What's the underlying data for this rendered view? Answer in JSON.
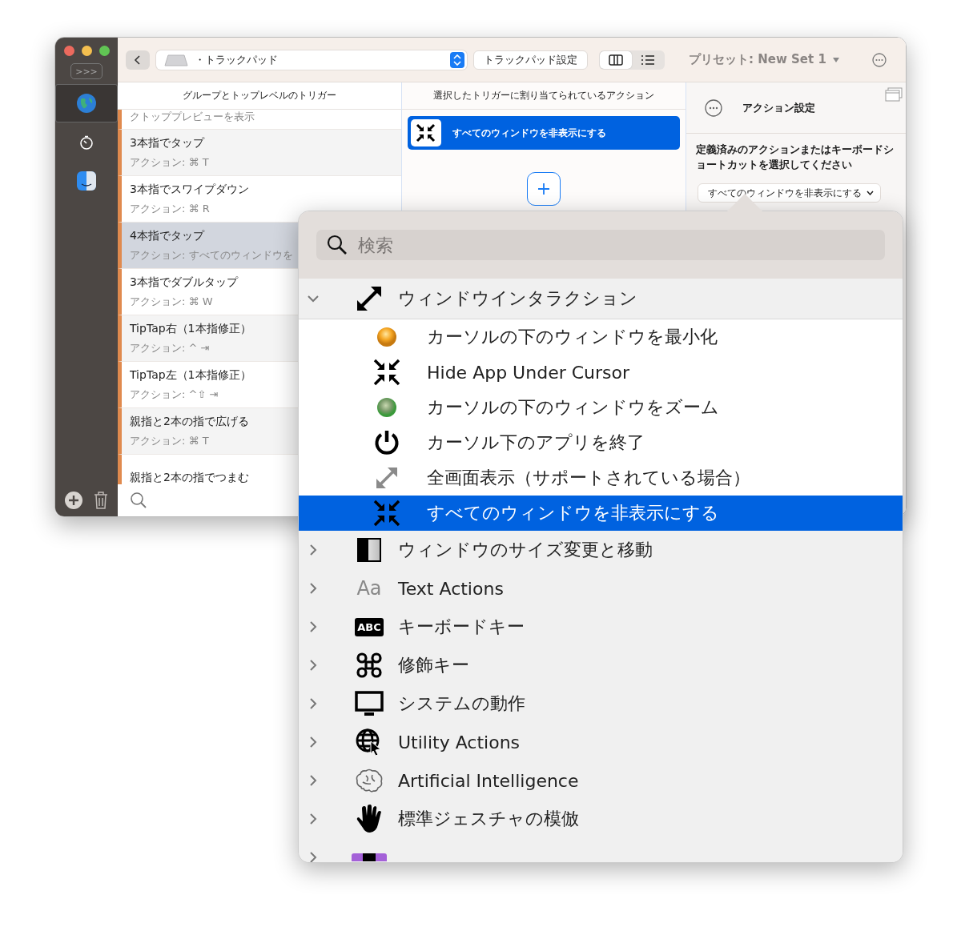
{
  "sidebar": {
    "expand_label": ">>>",
    "items": [
      {
        "kind": "globe",
        "selected": true
      },
      {
        "kind": "timer",
        "selected": false
      },
      {
        "kind": "app",
        "selected": false
      }
    ]
  },
  "toolbar": {
    "device": "・トラックパッド",
    "settings_button": "トラックパッド設定",
    "views": [
      {
        "kind": "columns",
        "selected": true
      },
      {
        "kind": "list",
        "selected": false
      }
    ],
    "preset": "プリセット: New Set 1"
  },
  "triggers": {
    "header": "グループとトップレベルのトリガー",
    "items": [
      {
        "action": "クトッププレビューを表示",
        "selected": false
      },
      {
        "title": "3本指でタップ",
        "action": "アクション: ⌘ T",
        "selected": false
      },
      {
        "title": "3本指でスワイプダウン",
        "action": "アクション: ⌘ R",
        "selected": false
      },
      {
        "title": "4本指でタップ",
        "action": "アクション: すべてのウィンドウを",
        "selected": true
      },
      {
        "title": "3本指でダブルタップ",
        "action": "アクション: ⌘ W",
        "selected": false
      },
      {
        "title": "TipTap右（1本指修正）",
        "action": "アクション: ^ ⇥",
        "selected": false
      },
      {
        "title": "TipTap左（1本指修正）",
        "action": "アクション: ^⇧ ⇥",
        "selected": false
      },
      {
        "title": "親指と2本の指で広げる",
        "action": "アクション: ⌘ T",
        "selected": false
      },
      {
        "title": "親指と2本の指でつまむ",
        "selected": false
      }
    ]
  },
  "actions": {
    "header": "選択したトリガーに割り当てられているアクション",
    "items": [
      {
        "label": "すべてのウィンドウを非表示にする",
        "selected": true
      }
    ]
  },
  "settings": {
    "title": "アクション設定",
    "description": "定義済みのアクションまたはキーボードショートカットを選択してください",
    "dropdown": "すべてのウィンドウを非表示にする"
  },
  "popup": {
    "search": {
      "placeholder": "検索"
    },
    "groups": [
      {
        "label": "ウィンドウインタラクション",
        "kind": "expand",
        "expanded": true,
        "children": [
          {
            "label": "カーソルの下のウィンドウを最小化",
            "kind": "minimize",
            "selected": false
          },
          {
            "label": "Hide App Under Cursor",
            "kind": "compress",
            "selected": false
          },
          {
            "label": "カーソルの下のウィンドウをズーム",
            "kind": "zoom",
            "selected": false
          },
          {
            "label": "カーソル下のアプリを終了",
            "kind": "power",
            "selected": false
          },
          {
            "label": "全画面表示（サポートされている場合）",
            "kind": "fullscreen",
            "selected": false
          },
          {
            "label": "すべてのウィンドウを非表示にする",
            "kind": "compress",
            "selected": true
          }
        ]
      },
      {
        "label": "ウィンドウのサイズ変更と移動",
        "kind": "half",
        "expanded": false
      },
      {
        "label": "Text Actions",
        "kind": "text",
        "icon_text": "Aa",
        "expanded": false
      },
      {
        "label": "キーボードキー",
        "kind": "keycap",
        "icon_text": "ABC",
        "expanded": false
      },
      {
        "label": "修飾キー",
        "kind": "command",
        "expanded": false
      },
      {
        "label": "システムの動作",
        "kind": "monitor",
        "expanded": false
      },
      {
        "label": "Utility Actions",
        "kind": "globe-cursor",
        "expanded": false
      },
      {
        "label": "Artificial Intelligence",
        "kind": "brain",
        "expanded": false
      },
      {
        "label": "標準ジェスチャの模倣",
        "kind": "hand",
        "expanded": false
      },
      {
        "kind": "notch",
        "expanded": false
      }
    ]
  }
}
